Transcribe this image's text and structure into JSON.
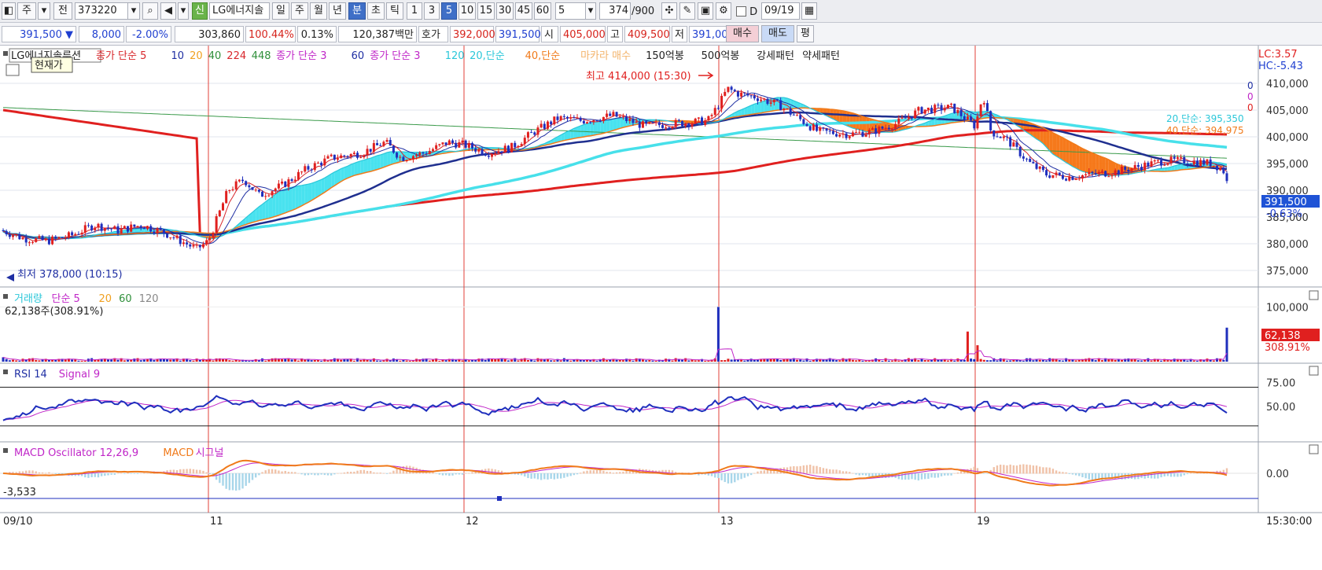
{
  "toolbar": {
    "period_btn": "주",
    "prev_btn": "전",
    "code_value": "373220",
    "new_badge": "신",
    "stock_name": "LG에너지솔",
    "tf_day": "일",
    "tf_week": "주",
    "tf_month": "월",
    "tf_year": "년",
    "tf_min": "분",
    "tf_sec": "초",
    "tf_tick": "틱",
    "intervals": [
      "1",
      "3",
      "5",
      "10",
      "15",
      "30",
      "45",
      "60"
    ],
    "selected_interval": "5",
    "interval_value": "5",
    "count_value": "374",
    "count_max": "/900",
    "d_label": "D",
    "date_value": "09/19"
  },
  "infobar": {
    "price": "391,500",
    "change_arrow": "▼",
    "change": "8,000",
    "change_pct": "-2.00%",
    "volume": "303,860",
    "vol_ratio": "100.44%",
    "turnover": "0.13%",
    "amount": "120,387백만",
    "quote_label": "호가",
    "bid": "392,000",
    "ask": "391,500",
    "open_label": "시",
    "open": "405,000",
    "high_label": "고",
    "high": "409,500",
    "low_label": "저",
    "low": "391,000",
    "buy_btn": "매수",
    "sell_btn": "매도",
    "eval_btn": "평"
  },
  "price_panel": {
    "legend": [
      {
        "text": "LG에너지솔루션",
        "color": "#222222"
      },
      {
        "text": "종가 단순 5",
        "color": "#d8262b"
      },
      {
        "text": "10",
        "color": "#1f2fa3"
      },
      {
        "text": "20",
        "color": "#f0a020"
      },
      {
        "text": "40",
        "color": "#2f8f3a"
      },
      {
        "text": "224",
        "color": "#d8262b"
      },
      {
        "text": "448",
        "color": "#2f8f3a"
      },
      {
        "text": "종가 단순 3",
        "color": "#c026c8"
      },
      {
        "text": "60",
        "color": "#1f2fa3"
      },
      {
        "text": "종가 단순 3",
        "color": "#c026c8"
      },
      {
        "text": "120",
        "color": "#2bc7d9"
      },
      {
        "text": "20,단순",
        "color": "#2bc7d9"
      },
      {
        "text": "40,단순",
        "color": "#f07a1a"
      },
      {
        "text": "마카라 매수",
        "color": "#f3b36b"
      },
      {
        "text": "150억봉",
        "color": "#222222"
      },
      {
        "text": "500억봉",
        "color": "#222222"
      },
      {
        "text": "강세패턴",
        "color": "#222222"
      },
      {
        "text": "약세패턴",
        "color": "#222222"
      }
    ],
    "tooltip": "현재가",
    "lc_label": "LC:3.57",
    "hc_label": "HC:-5.43",
    "high_note": "최고 414,000 (15:30)",
    "low_note": "최저 378,000 (10:15)",
    "ma20_note": "20,단순: 395,350",
    "ma40_note": "40,단순: 394,975",
    "zero_labels": [
      "0",
      "0",
      "0"
    ],
    "current_price_tag": "391,500",
    "current_change_tag": "-0.63%",
    "y_ticks": [
      "410,000",
      "405,000",
      "400,000",
      "395,000",
      "390,000",
      "385,000",
      "380,000",
      "375,000"
    ]
  },
  "volume_panel": {
    "legend": [
      {
        "text": "거래량",
        "color": "#2bc7d9"
      },
      {
        "text": "단순 5",
        "color": "#c026c8"
      },
      {
        "text": "20",
        "color": "#f0a020"
      },
      {
        "text": "60",
        "color": "#2f8f3a"
      },
      {
        "text": "120",
        "color": "#888888"
      }
    ],
    "value_note": "62,138주(308.91%)",
    "y_tick": "100,000",
    "current_tag": "62,138",
    "current_pct": "308.91%"
  },
  "rsi_panel": {
    "legend": [
      {
        "text": "RSI 14",
        "color": "#1f2fa3"
      },
      {
        "text": "Signal 9",
        "color": "#c026c8"
      }
    ],
    "y_ticks": [
      "75.00",
      "50.00"
    ]
  },
  "macd_panel": {
    "legend": [
      {
        "text": "MACD Oscillator 12,26,9",
        "color": "#c026c8"
      },
      {
        "text": "MACD",
        "color": "#f07a1a"
      },
      {
        "text": "시그널",
        "color": "#c026c8"
      }
    ],
    "value_note": "-3,533",
    "y_tick": "0.00"
  },
  "x_axis": {
    "labels": [
      "09/10",
      "11",
      "12",
      "13",
      "19"
    ],
    "time_label": "15:30:00"
  },
  "colors": {
    "up": "#e0201f",
    "down": "#1f2fbd",
    "ma_red": "#e0201f",
    "ma_navy": "#1f2f8f",
    "ma_cyan": "#47e0ea",
    "cloud_orange": "#f5720f",
    "cloud_cyan": "#3fe0ee"
  }
}
